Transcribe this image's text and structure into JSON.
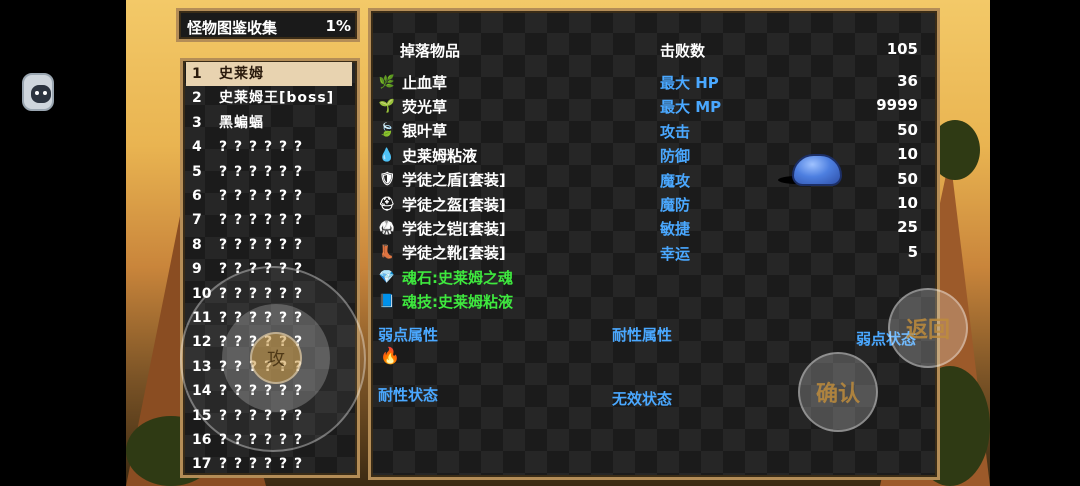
{
  "header": {
    "title": "怪物图鉴收集",
    "percent": "1%"
  },
  "monsters": [
    {
      "num": "1",
      "name": "史莱姆",
      "selected": true
    },
    {
      "num": "2",
      "name": "史莱姆王[boss]"
    },
    {
      "num": "3",
      "name": "黑蝙蝠"
    },
    {
      "num": "4",
      "name": "? ? ? ? ? ?"
    },
    {
      "num": "5",
      "name": "? ? ? ? ? ?"
    },
    {
      "num": "6",
      "name": "? ? ? ? ? ?"
    },
    {
      "num": "7",
      "name": "? ? ? ? ? ?"
    },
    {
      "num": "8",
      "name": "? ? ? ? ? ?"
    },
    {
      "num": "9",
      "name": "? ? ? ? ? ?"
    },
    {
      "num": "10",
      "name": "? ? ? ? ? ?"
    },
    {
      "num": "11",
      "name": "? ? ? ? ? ?"
    },
    {
      "num": "12",
      "name": "? ? ? ? ? ?"
    },
    {
      "num": "13",
      "name": "? ? ? ? ? ?"
    },
    {
      "num": "14",
      "name": "? ? ? ? ? ?"
    },
    {
      "num": "15",
      "name": "? ? ? ? ? ?"
    },
    {
      "num": "16",
      "name": "? ? ? ? ? ?"
    },
    {
      "num": "17",
      "name": "? ? ? ? ? ?"
    }
  ],
  "drops": {
    "label": "掉落物品",
    "items": [
      {
        "name": "止血草",
        "icon": "herb-icon",
        "color": "#ffffff"
      },
      {
        "name": "荧光草",
        "icon": "glowgrass-icon",
        "color": "#ffffff"
      },
      {
        "name": "银叶草",
        "icon": "silverleaf-icon",
        "color": "#ffffff"
      },
      {
        "name": "史莱姆粘液",
        "icon": "slime-drop-icon",
        "color": "#ffffff"
      },
      {
        "name": "学徒之盾[套装]",
        "icon": "shield-icon",
        "color": "#ffffff"
      },
      {
        "name": "学徒之盔[套装]",
        "icon": "helmet-icon",
        "color": "#ffffff"
      },
      {
        "name": "学徒之铠[套装]",
        "icon": "armor-icon",
        "color": "#ffffff"
      },
      {
        "name": "学徒之靴[套装]",
        "icon": "boots-icon",
        "color": "#ffffff"
      },
      {
        "name": "魂石:史莱姆之魂",
        "icon": "soulstone-icon",
        "color": "#3ee83e"
      },
      {
        "name": "魂技:史莱姆粘液",
        "icon": "skillbook-icon",
        "color": "#3ee83e"
      }
    ]
  },
  "stats": {
    "defeat_label": "击败数",
    "defeat_value": "105",
    "rows": [
      {
        "label": "最大 HP",
        "value": "36"
      },
      {
        "label": "最大 MP",
        "value": "9999"
      },
      {
        "label": "攻击",
        "value": "50"
      },
      {
        "label": "防御",
        "value": "10"
      },
      {
        "label": "魔攻",
        "value": "50"
      },
      {
        "label": "魔防",
        "value": "10"
      },
      {
        "label": "敏捷",
        "value": "25"
      },
      {
        "label": "幸运",
        "value": "5"
      }
    ]
  },
  "attributes": {
    "weak_attr": "弱点属性",
    "resist_attr": "耐性属性",
    "weak_state": "弱点状态",
    "resist_state": "耐性状态",
    "immune_state": "无效状态",
    "weak_attr_icon": "fire-icon"
  },
  "controls": {
    "back": "返回",
    "confirm": "确认",
    "joystick_knob": "攻"
  },
  "colors": {
    "accent_blue": "#4aa8ff",
    "green": "#3ee83e",
    "panel_border": "#b48d57",
    "selected_bg": "#e8d3b0"
  }
}
